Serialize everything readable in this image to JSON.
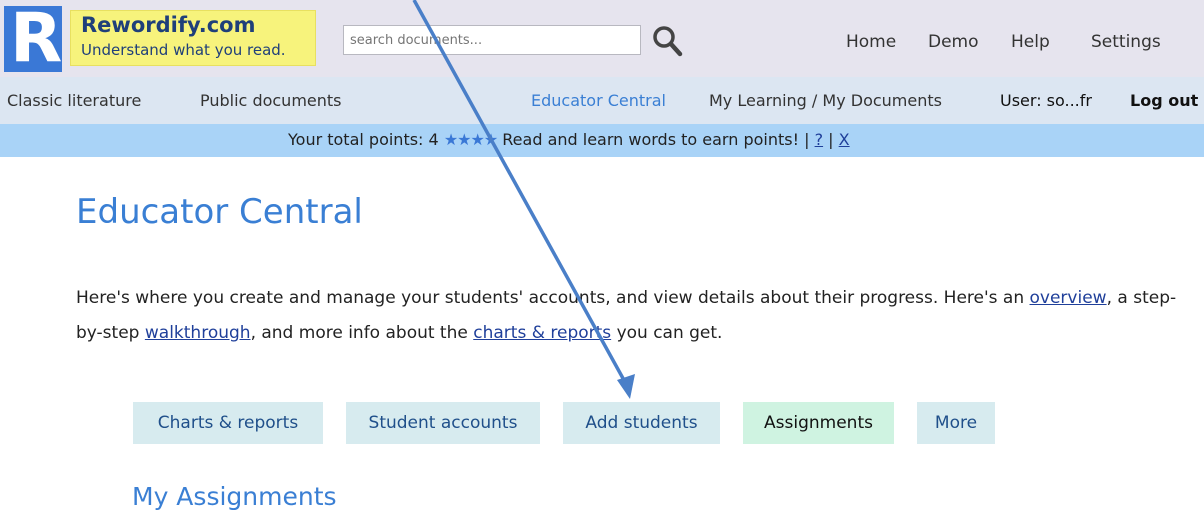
{
  "brand": {
    "logo_letter": "R",
    "name": "Rewordify.com",
    "tagline": "Understand what you read."
  },
  "search": {
    "placeholder": "search documents..."
  },
  "top_nav": [
    "Home",
    "Demo",
    "Help",
    "Settings"
  ],
  "sub_nav": {
    "left": [
      "Classic literature",
      "Public documents"
    ],
    "educator": "Educator Central",
    "my_learning": "My Learning / My Documents",
    "user": "User: so...fr",
    "logout": "Log out"
  },
  "points": {
    "prefix": "Your total points: 4",
    "stars": "★★★★",
    "suffix": "Read and learn words to earn points! |",
    "help": "?",
    "sep": "|",
    "close": "X"
  },
  "page_title": "Educator Central",
  "intro": {
    "part1": "Here's where you create and manage your students' accounts, and view details about their progress. Here's an",
    "link_overview": "overview",
    "part2": ", a step-by-step",
    "link_walkthrough": "walkthrough",
    "part3": ", and more info about the",
    "link_charts": "charts & reports",
    "part4": "you can get."
  },
  "tabs": [
    "Charts & reports",
    "Student accounts",
    "Add students",
    "Assignments",
    "More"
  ],
  "active_tab": "Assignments",
  "section_title": "My Assignments",
  "colors": {
    "accent_blue": "#3a7fd4",
    "logo_yellow": "#f7f37c",
    "points_bar": "#a9d3f7",
    "tab_bg": "#d7ebef",
    "tab_active_bg": "#cff3e1",
    "annotation_arrow": "#4a7fc8"
  }
}
